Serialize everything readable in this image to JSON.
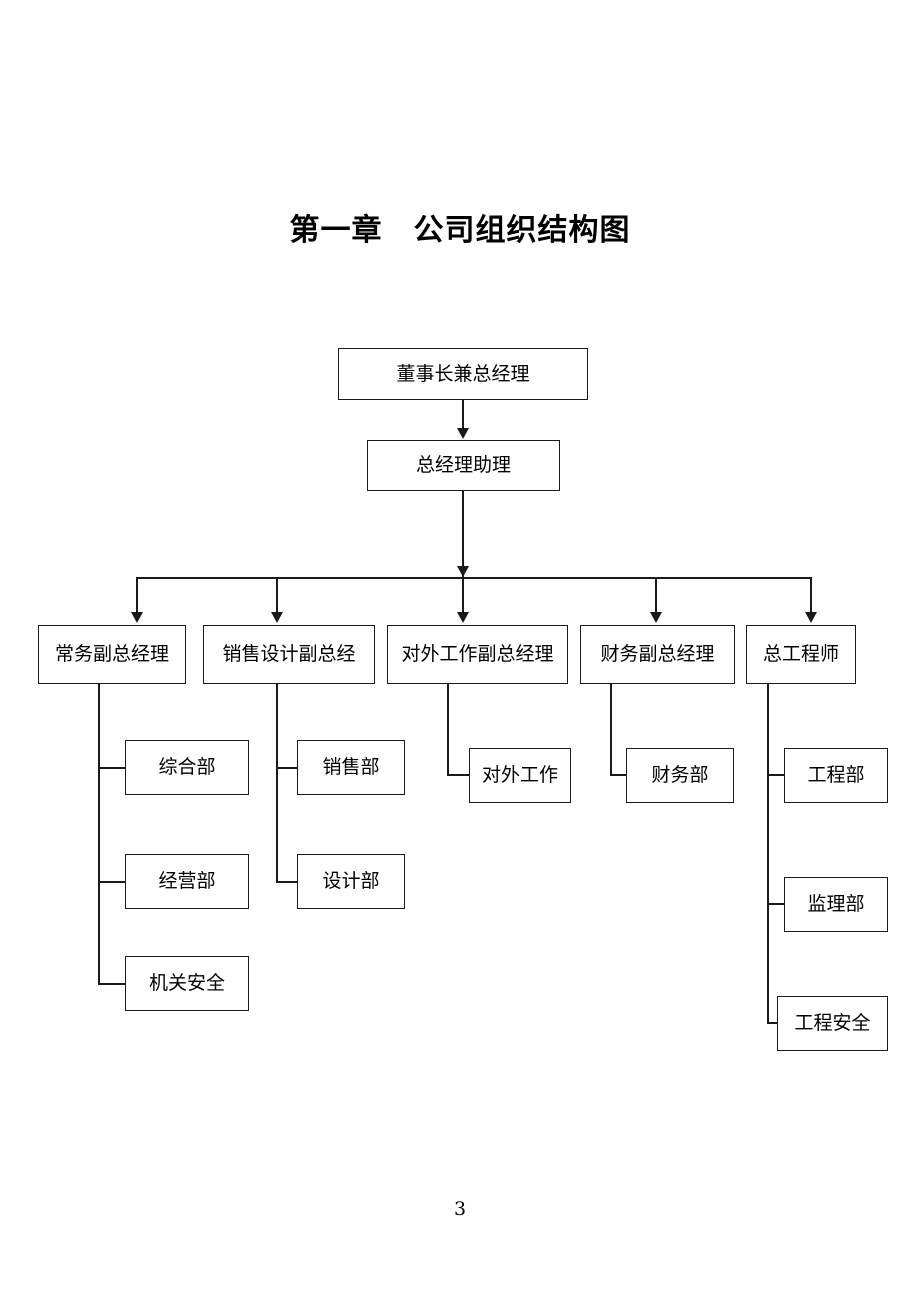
{
  "document": {
    "title": "第一章　公司组织结构图",
    "page_number": "3"
  },
  "chart_data": {
    "type": "diagram",
    "diagram_kind": "organization-chart",
    "title": "第一章　公司组织结构图",
    "levels": [
      {
        "level": 1,
        "nodes": [
          {
            "id": "chairman",
            "label": "董事长兼总经理"
          }
        ]
      },
      {
        "level": 2,
        "nodes": [
          {
            "id": "assistant",
            "label": "总经理助理"
          }
        ]
      },
      {
        "level": 3,
        "nodes": [
          {
            "id": "exec-vp",
            "label": "常务副总经理"
          },
          {
            "id": "sales-design-vp",
            "label": "销售设计副总经"
          },
          {
            "id": "external-vp",
            "label": "对外工作副总经理"
          },
          {
            "id": "finance-vp",
            "label": "财务副总经理"
          },
          {
            "id": "chief-engineer",
            "label": "总工程师"
          }
        ]
      },
      {
        "level": 4,
        "nodes": [
          {
            "id": "general-dept",
            "label": "综合部",
            "parent": "exec-vp"
          },
          {
            "id": "operations-dept",
            "label": "经营部",
            "parent": "exec-vp"
          },
          {
            "id": "office-security",
            "label": "机关安全",
            "parent": "exec-vp"
          },
          {
            "id": "sales-dept",
            "label": "销售部",
            "parent": "sales-design-vp"
          },
          {
            "id": "design-dept",
            "label": "设计部",
            "parent": "sales-design-vp"
          },
          {
            "id": "external-affairs",
            "label": "对外工作",
            "parent": "external-vp"
          },
          {
            "id": "finance-dept",
            "label": "财务部",
            "parent": "finance-vp"
          },
          {
            "id": "engineering-dept",
            "label": "工程部",
            "parent": "chief-engineer"
          },
          {
            "id": "supervision-dept",
            "label": "监理部",
            "parent": "chief-engineer"
          },
          {
            "id": "engineering-safety",
            "label": "工程安全",
            "parent": "chief-engineer"
          }
        ]
      }
    ],
    "edges": [
      {
        "from": "chairman",
        "to": "assistant",
        "style": "arrow"
      },
      {
        "from": "assistant",
        "to": "exec-vp",
        "style": "arrow"
      },
      {
        "from": "assistant",
        "to": "sales-design-vp",
        "style": "arrow"
      },
      {
        "from": "assistant",
        "to": "external-vp",
        "style": "arrow"
      },
      {
        "from": "assistant",
        "to": "finance-vp",
        "style": "arrow"
      },
      {
        "from": "assistant",
        "to": "chief-engineer",
        "style": "arrow"
      },
      {
        "from": "exec-vp",
        "to": "general-dept",
        "style": "elbow"
      },
      {
        "from": "exec-vp",
        "to": "operations-dept",
        "style": "elbow"
      },
      {
        "from": "exec-vp",
        "to": "office-security",
        "style": "elbow"
      },
      {
        "from": "sales-design-vp",
        "to": "sales-dept",
        "style": "elbow"
      },
      {
        "from": "sales-design-vp",
        "to": "design-dept",
        "style": "elbow"
      },
      {
        "from": "external-vp",
        "to": "external-affairs",
        "style": "elbow"
      },
      {
        "from": "finance-vp",
        "to": "finance-dept",
        "style": "elbow"
      },
      {
        "from": "chief-engineer",
        "to": "engineering-dept",
        "style": "elbow"
      },
      {
        "from": "chief-engineer",
        "to": "supervision-dept",
        "style": "elbow"
      },
      {
        "from": "chief-engineer",
        "to": "engineering-safety",
        "style": "elbow"
      }
    ],
    "colors": {
      "box_border": "#1a1a1a",
      "box_fill": "#ffffff",
      "line": "#1a1a1a",
      "text": "#000000",
      "background": "#ffffff"
    }
  }
}
